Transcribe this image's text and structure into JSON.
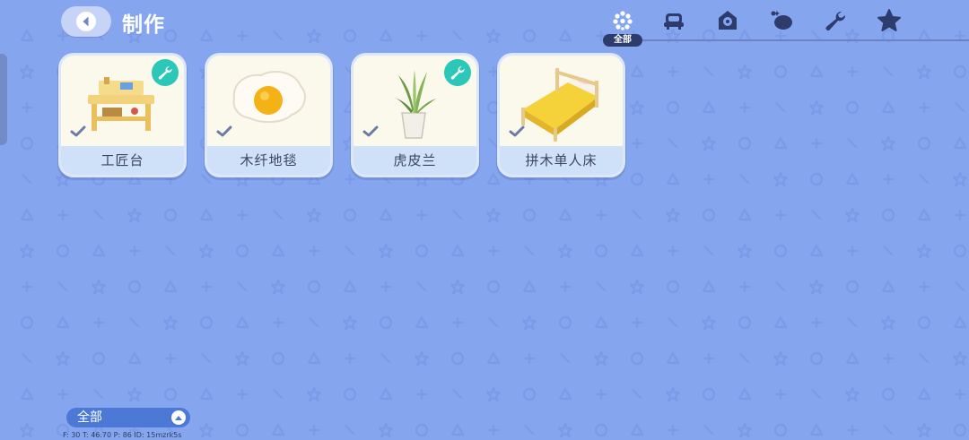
{
  "header": {
    "title": "制作",
    "back_icon": "back-arrow-icon"
  },
  "categories": {
    "selected_label": "全部",
    "items": [
      {
        "icon": "all-dots-icon"
      },
      {
        "icon": "furniture-icon"
      },
      {
        "icon": "house-gear-icon"
      },
      {
        "icon": "wallpaper-icon"
      },
      {
        "icon": "wrench-icon"
      },
      {
        "icon": "star-icon"
      }
    ]
  },
  "recipes": [
    {
      "name": "工匠台",
      "has_tool_badge": true
    },
    {
      "name": "木纤地毯",
      "has_tool_badge": false
    },
    {
      "name": "虎皮兰",
      "has_tool_badge": true
    },
    {
      "name": "拼木单人床",
      "has_tool_badge": false
    }
  ],
  "filter": {
    "label": "全部"
  },
  "debug": {
    "text": "F: 30    T: 46.70    P: 86    ID: 15mzrk5s"
  },
  "colors": {
    "background": "#86a5ef",
    "badge": "#2bc7b8",
    "label_bar": "#cfe0f9",
    "filter": "#4c79d6"
  }
}
